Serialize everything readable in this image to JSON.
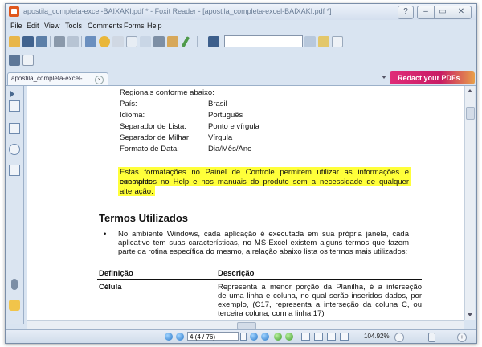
{
  "window": {
    "title": "apostila_completa-excel-BAIXAKI.pdf * - Foxit Reader - [apostila_completa-excel-BAIXAKI.pdf *]",
    "controls": {
      "help": "?",
      "minimize": "–",
      "maximize": "▭",
      "close": "✕"
    }
  },
  "menu": [
    "File",
    "Edit",
    "View",
    "Tools",
    "Comments",
    "Forms",
    "Help"
  ],
  "tab": {
    "label": "apostila_completa-excel-...",
    "close": "×"
  },
  "redact_button": "Redact your PDFs",
  "document": {
    "intro": "Regionais conforme abaixo:",
    "settings": [
      {
        "label": "País:",
        "value": "Brasil"
      },
      {
        "label": "Idioma:",
        "value": "Português"
      },
      {
        "label": "Separador de Lista:",
        "value": "Ponto e vírgula"
      },
      {
        "label": "Separador de Milhar:",
        "value": "Vírgula"
      },
      {
        "label": "Formato de Data:",
        "value": "Dia/Mês/Ano"
      }
    ],
    "highlight_lines": [
      "Estas formatações no Painel de Controle permitem utilizar as informações e exemplos",
      "constantes no Help e nos manuais do produto sem a necessidade de qualquer",
      "alteração."
    ],
    "section_title": "Termos Utilizados",
    "bullet_lines": [
      "No ambiente Windows, cada aplicação é executada em sua própria janela, cada",
      "aplicativo tem suas características, no MS-Excel existem alguns termos que fazem",
      "parte da rotina específica do mesmo, a relação abaixo lista os termos mais utilizados:"
    ],
    "table": {
      "headers": [
        "Definição",
        "Descrição"
      ],
      "rows": [
        {
          "term": "Célula",
          "description_lines": [
            "Representa a menor porção da Planilha, é a interseção",
            "de uma linha e coluna, no qual serão inseridos dados, por",
            "exemplo, (C17, representa a interseção da coluna C, ou",
            "terceira coluna, com a linha 17)"
          ]
        }
      ]
    }
  },
  "status": {
    "page_input": "4 (4 / 76)",
    "zoom": "104.92%",
    "zoom_minus": "−",
    "zoom_plus": "+"
  },
  "colors": {
    "highlight": "#ffff3a",
    "redact_button": "#e02c78",
    "app_icon": "#e0571d"
  }
}
